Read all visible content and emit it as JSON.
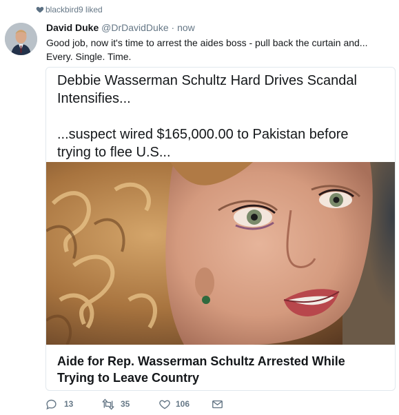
{
  "context": {
    "liked_by": "blackbird9 liked"
  },
  "tweet": {
    "author_name": "David Duke",
    "author_handle": "@DrDavidDuke",
    "separator": "·",
    "timestamp": "now",
    "text_line1": "Good job, now it's time to arrest the aides boss - pull back the curtain and...",
    "text_line2": "Every. Single. Time."
  },
  "card": {
    "headline": "Debbie Wasserman Schultz Hard Drives Scandal Intensifies...",
    "subline": "...suspect wired $165,000.00 to Pakistan before trying to flee U.S...",
    "title": "Aide for Rep. Wasserman Schultz Arrested While Trying to Leave Country"
  },
  "actions": {
    "replies": "13",
    "retweets": "35",
    "likes": "106"
  },
  "colors": {
    "secondary_text": "#657786",
    "border": "#e1e8ed",
    "text": "#14171a"
  },
  "icons": {
    "context": "heart-icon",
    "reply": "reply-icon",
    "retweet": "retweet-icon",
    "like": "heart-outline-icon",
    "dm": "envelope-icon"
  }
}
